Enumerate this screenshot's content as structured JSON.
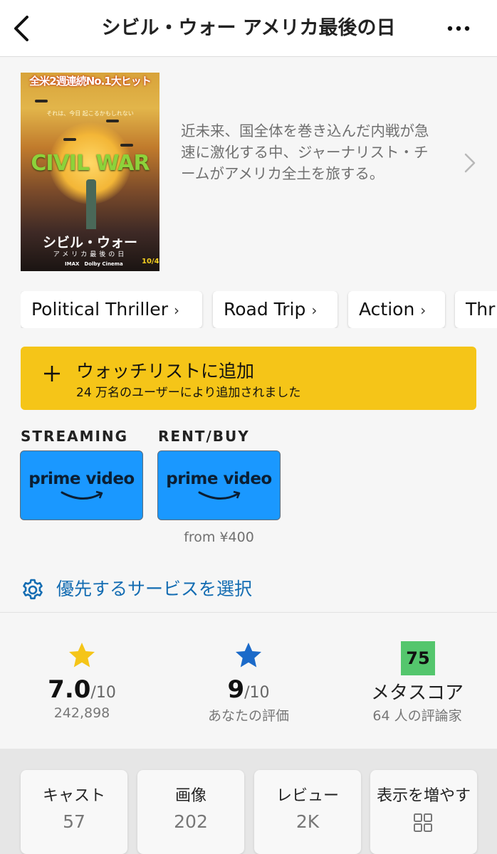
{
  "header": {
    "title": "シビル・ウォー アメリカ最後の日",
    "back_icon": "chevron-left-icon",
    "more_icon": "more-horizontal-icon"
  },
  "poster": {
    "top_banner": "全米2週連続No.1大ヒット",
    "tagline": "それは、今日 起こるかもしれない",
    "title_en": "CIVIL WAR",
    "title_jp": "シビル・ウォー",
    "subtitle_jp": "アメリカ最後の日",
    "imax": "IMAX　Dolby Cinema",
    "date": "10/4"
  },
  "overview": {
    "synopsis": "近未来、国全体を巻き込んだ内戦が急速に激化する中、ジャーナリスト・チームがアメリカ全土を旅する。"
  },
  "genres": [
    {
      "label": "Political Thriller"
    },
    {
      "label": "Road Trip"
    },
    {
      "label": "Action"
    },
    {
      "label": "Thr"
    }
  ],
  "watchlist": {
    "title": "ウォッチリストに追加",
    "subtitle": "24 万名のユーザーにより追加されました"
  },
  "providers": {
    "streaming_label": "STREAMING",
    "rent_label": "RENT/BUY",
    "streaming_service": "prime video",
    "rent_service": "prime video",
    "rent_price": "from ¥400",
    "tile_color": "#1a98ff"
  },
  "preference": {
    "label": "優先するサービスを選択"
  },
  "ratings": {
    "imdb": {
      "value": "7.0",
      "scale": "/10",
      "count": "242,898"
    },
    "user": {
      "value": "9",
      "scale": "/10",
      "label": "あなたの評価"
    },
    "metascore": {
      "value": "75",
      "label": "メタスコア",
      "critics": "64 人の評論家",
      "badge_color": "#54c66d"
    }
  },
  "tiles": [
    {
      "label": "キャスト",
      "value": "57"
    },
    {
      "label": "画像",
      "value": "202"
    },
    {
      "label": "レビュー",
      "value": "2K"
    },
    {
      "label": "表示を増やす",
      "icon": "grid-icon"
    }
  ],
  "colors": {
    "accent_yellow": "#f5c518",
    "link_blue": "#136cb2",
    "user_star_blue": "#1b6ac9"
  }
}
